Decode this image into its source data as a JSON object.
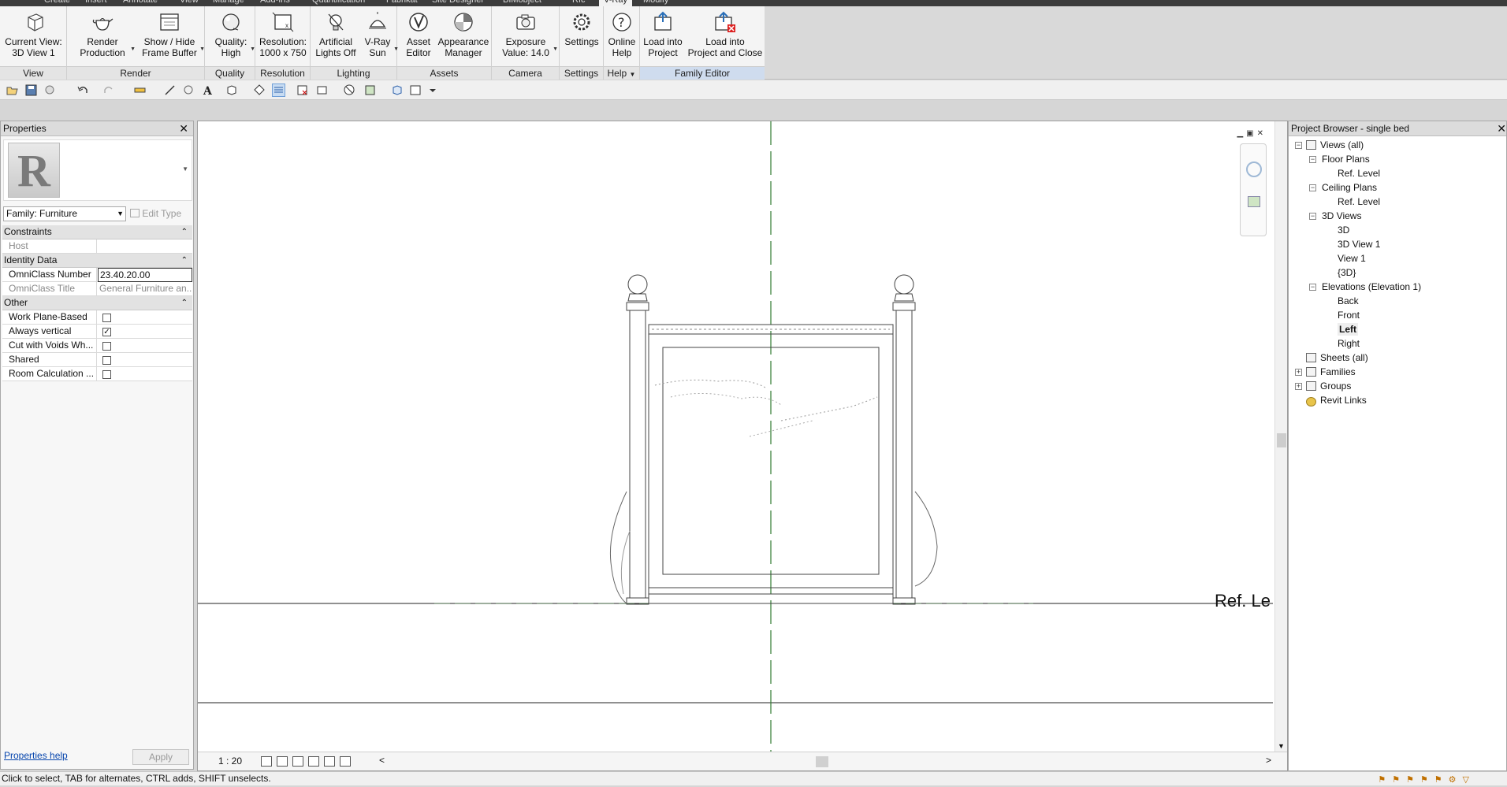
{
  "tabs": [
    "Create",
    "Insert",
    "Annotate",
    "View",
    "Manage",
    "Add-Ins",
    "Quantification",
    "Fabrikat",
    "Site Designer",
    "BIMobject",
    "Rfc",
    "V-Ray",
    "Modify"
  ],
  "active_tab": "V-Ray",
  "ribbon": {
    "view": {
      "title": "View",
      "current_view": "Current View:",
      "current_view_value": "3D View 1"
    },
    "render": {
      "title": "Render",
      "render_production_1": "Render",
      "render_production_2": "Production",
      "frame_buffer_1": "Show / Hide",
      "frame_buffer_2": "Frame Buffer"
    },
    "quality": {
      "title": "Quality",
      "label_1": "Quality:",
      "label_2": "High"
    },
    "resolution": {
      "title": "Resolution",
      "label_1": "Resolution:",
      "label_2": "1000 x 750"
    },
    "lighting": {
      "title": "Lighting",
      "artificial_1": "Artificial",
      "artificial_2": "Lights Off",
      "sun_1": "V-Ray",
      "sun_2": "Sun"
    },
    "assets": {
      "title": "Assets",
      "asset_1": "Asset",
      "asset_2": "Editor",
      "appearance_1": "Appearance",
      "appearance_2": "Manager"
    },
    "camera": {
      "title": "Camera",
      "exposure_1": "Exposure",
      "exposure_2": "Value: 14.0"
    },
    "settings": {
      "title": "Settings",
      "label": "Settings"
    },
    "help": {
      "title": "Help",
      "online_1": "Online",
      "online_2": "Help"
    },
    "family_editor": {
      "title": "Family Editor",
      "load_1": "Load into",
      "load_2": "Project",
      "load_close_1": "Load into",
      "load_close_2": "Project and Close"
    }
  },
  "properties": {
    "title": "Properties",
    "family_selector": "Family: Furniture",
    "edit_type": "Edit Type",
    "groups": {
      "constraints": "Constraints",
      "identity": "Identity Data",
      "other": "Other"
    },
    "rows": {
      "host_key": "Host",
      "host_val": "",
      "omniclass_number_key": "OmniClass Number",
      "omniclass_number_val": "23.40.20.00",
      "omniclass_title_key": "OmniClass Title",
      "omniclass_title_val": "General Furniture an...",
      "work_plane": "Work Plane-Based",
      "always_vertical": "Always vertical",
      "cut_voids": "Cut with Voids Wh...",
      "shared": "Shared",
      "room_calc": "Room Calculation ..."
    },
    "checks": {
      "work_plane": false,
      "always_vertical": true,
      "cut_voids": false,
      "shared": false,
      "room_calc": false
    },
    "help_link": "Properties help",
    "apply": "Apply"
  },
  "view": {
    "scale": "1 : 20",
    "level_label": "Ref. Le"
  },
  "project_browser": {
    "title": "Project Browser - single bed",
    "nodes": {
      "views_all": "Views (all)",
      "floor_plans": "Floor Plans",
      "fp_ref": "Ref. Level",
      "ceiling_plans": "Ceiling Plans",
      "cp_ref": "Ref. Level",
      "views_3d": "3D Views",
      "v3d": "3D",
      "v3d1": "3D View 1",
      "view1": "View 1",
      "v3d_braces": "{3D}",
      "elevations": "Elevations (Elevation 1)",
      "back": "Back",
      "front": "Front",
      "left": "Left",
      "right": "Right",
      "sheets": "Sheets (all)",
      "families": "Families",
      "groups": "Groups",
      "revit_links": "Revit Links"
    }
  },
  "status": "Click to select, TAB for alternates, CTRL adds, SHIFT unselects."
}
